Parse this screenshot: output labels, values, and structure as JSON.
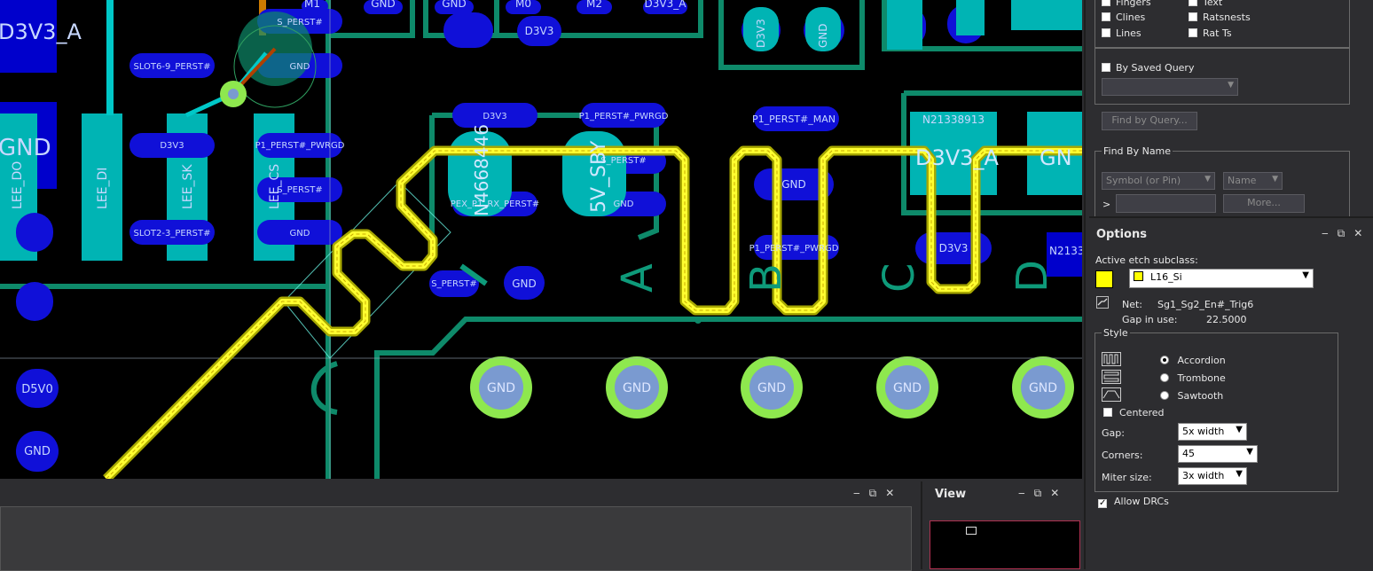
{
  "find_panel": {
    "checkboxes": [
      {
        "label": "Fingers",
        "checked": false
      },
      {
        "label": "Text",
        "checked": false
      },
      {
        "label": "Clines",
        "checked": false
      },
      {
        "label": "Ratsnests",
        "checked": false
      },
      {
        "label": "Lines",
        "checked": false
      },
      {
        "label": "Rat Ts",
        "checked": false
      }
    ],
    "by_saved_query": "By Saved Query",
    "find_by_query_button": "Find by Query...",
    "find_by_name": {
      "title": "Find By Name",
      "type_select": "Symbol (or Pin)",
      "name_select": "Name",
      "prompt": ">",
      "more_button": "More..."
    }
  },
  "options": {
    "title": "Options",
    "active_etch_label": "Active etch subclass:",
    "active_etch_value": "L16_Si",
    "active_etch_color": "#ffff00",
    "net_label": "Net:",
    "net_value": "Sg1_Sg2_En#_Trig6",
    "gap_in_use_label": "Gap in use:",
    "gap_in_use_value": "22.5000",
    "style": {
      "title": "Style",
      "options": [
        {
          "label": "Accordion",
          "selected": true,
          "icon": "accordion-icon"
        },
        {
          "label": "Trombone",
          "selected": false,
          "icon": "trombone-icon"
        },
        {
          "label": "Sawtooth",
          "selected": false,
          "icon": "sawtooth-icon"
        }
      ],
      "centered_label": "Centered",
      "centered_checked": false,
      "gap_label": "Gap:",
      "gap_value": "5x width",
      "corners_label": "Corners:",
      "corners_value": "45",
      "miter_label": "Miter size:",
      "miter_value": "3x width"
    },
    "allow_drcs_label": "Allow DRCs",
    "allow_drcs_checked": true
  },
  "view_panel": {
    "title": "View"
  },
  "canvas_labels": {
    "top_row": [
      "M1",
      "GND",
      "GND",
      "M0",
      "M2",
      "D3V3_A"
    ],
    "d3v3_a_left": "D3V3_A",
    "gnd_left": "GND",
    "lee_do": "LEE_DO",
    "lee_di": "LEE_DI",
    "lee_sk": "LEE_SK",
    "lee_cs": "LEE_CS",
    "s_perst_1": "S_PERST#",
    "slot6": "SLOT6-9_PERST#",
    "gnd_a": "GND",
    "d3v3_small": "D3V3",
    "p1_pwrgd": "P1_PERST#_PWRGD",
    "s_perst_2": "S_PERST#",
    "slot2": "SLOT2-3_PERST#",
    "gnd_b": "GND",
    "d3v3_top": "D3V3",
    "d3v3_box": "D3V3",
    "p1_pwrgd_2": "P1_PERST#_PWRGD",
    "n4668": "N4668446",
    "v5_sby": "5V_SBY",
    "s_perst_3": "S_PERST#",
    "pex": "PEX_P1_RX_PERST#",
    "gnd_c": "GND",
    "p1_man": "P1_PERST#_MAN",
    "gnd_d": "GND",
    "p1_pwrgd_3": "P1_PERST#_PWRGD",
    "d3v3_right": "D3V3",
    "n21338913": "N21338913",
    "d3v3_a_right": "D3V3_A",
    "gn_right": "GN",
    "n2133": "N2133",
    "s_perst_4": "S_PERST#",
    "gnd_e": "GND",
    "d5v0": "D5V0",
    "gnd_f": "GND",
    "gnd_row": [
      "GND",
      "GND",
      "GND",
      "GND",
      "GND"
    ],
    "silk_a": "A",
    "silk_b": "B",
    "silk_c": "C",
    "silk_d": "D",
    "gnd_top_right1": "GND",
    "d3v3_top_right": "D3V3"
  }
}
